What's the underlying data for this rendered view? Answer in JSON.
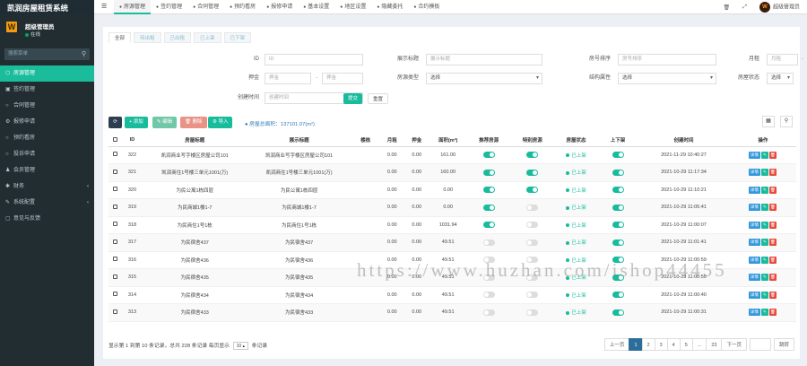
{
  "app": {
    "title": "凯润房屋租赁系统"
  },
  "user": {
    "name": "超级管理员",
    "status": "在线",
    "logo_letter": "W"
  },
  "sidebar": {
    "search_placeholder": "搜索菜单",
    "items": [
      {
        "label": "房源管理",
        "icon": "house-icon",
        "glyph": "⬡"
      },
      {
        "label": "签约管理",
        "icon": "contract-icon",
        "glyph": "▣"
      },
      {
        "label": "合同管理",
        "icon": "document-icon",
        "glyph": "○"
      },
      {
        "label": "报修申请",
        "icon": "repair-icon",
        "glyph": "⚙"
      },
      {
        "label": "预约看房",
        "icon": "calendar-icon",
        "glyph": "○"
      },
      {
        "label": "投诉申请",
        "icon": "complaint-icon",
        "glyph": "○"
      },
      {
        "label": "会员管理",
        "icon": "user-icon",
        "glyph": "♟"
      },
      {
        "label": "财务",
        "icon": "finance-icon",
        "glyph": "✱"
      },
      {
        "label": "系统配置",
        "icon": "settings-icon",
        "glyph": "✎"
      },
      {
        "label": "意见与反馈",
        "icon": "feedback-icon",
        "glyph": "▢"
      }
    ]
  },
  "topbar": {
    "tabs": [
      {
        "label": "房源管理"
      },
      {
        "label": "签约管理"
      },
      {
        "label": "合同管理"
      },
      {
        "label": "预约看房"
      },
      {
        "label": "报修申请"
      },
      {
        "label": "基本设置"
      },
      {
        "label": "地区设置"
      },
      {
        "label": "隐藏委托"
      },
      {
        "label": "合约模板"
      }
    ],
    "admin_name": "超级管理员"
  },
  "filter_tabs": [
    "全部",
    "待出租",
    "已出租",
    "已上架",
    "已下架"
  ],
  "filters": {
    "id": {
      "label": "ID",
      "placeholder": "ID"
    },
    "title": {
      "label": "展示标题",
      "placeholder": "展示标题"
    },
    "room_no": {
      "label": "房号排序",
      "placeholder": "房号排序"
    },
    "rent": {
      "label": "月租",
      "ph_min": "月租",
      "ph_max": "月租"
    },
    "deposit": {
      "label": "押金",
      "ph_min": "押金",
      "ph_max": "押金"
    },
    "source": {
      "label": "房源类型",
      "value": "选择"
    },
    "structure": {
      "label": "结构属性",
      "value": "选择"
    },
    "status": {
      "label": "房屋状态",
      "value": "选择"
    },
    "created": {
      "label": "创建时间",
      "placeholder": "创建时间"
    },
    "submit": "提交",
    "reset": "重置"
  },
  "toolbar": {
    "add": "+ 添加",
    "edit": "✎ 编辑",
    "delete": "🗑 删除",
    "import": "⚙ 导入",
    "stats": "房屋总面积：137101.07(m²)"
  },
  "table": {
    "headers": [
      "ID",
      "房屋标题",
      "展示标题",
      "楼栋",
      "月租",
      "押金",
      "面积(m²)",
      "推荐房源",
      "特别房源",
      "房屋状态",
      "上下架",
      "创建时间",
      "操作"
    ],
    "rows": [
      {
        "id": "322",
        "title": "凯润商业写字楼区房屋公司101",
        "show": "凯润商业写字楼区房屋公司101",
        "rent": "0.00",
        "deposit": "0.00",
        "area": "161.00",
        "rec": true,
        "special": true,
        "status": "已上架",
        "shelf": true,
        "created": "2021-11-29 10:40:27"
      },
      {
        "id": "321",
        "title": "凯润商住1号楼三单元1001(万)",
        "show": "凯润商住1号楼三单元1001(万)",
        "rent": "0.00",
        "deposit": "0.00",
        "area": "160.00",
        "rec": true,
        "special": true,
        "status": "已上架",
        "shelf": true,
        "created": "2021-10-29 11:17:34"
      },
      {
        "id": "320",
        "title": "为民公寓1栋四层",
        "show": "为民公寓1栋四层",
        "rent": "0.00",
        "deposit": "0.00",
        "area": "0.00",
        "rec": true,
        "special": true,
        "status": "已上架",
        "shelf": true,
        "created": "2021-10-29 11:10:21"
      },
      {
        "id": "319",
        "title": "为民商城1楼1-7",
        "show": "为民商城1楼1-7",
        "rent": "0.00",
        "deposit": "0.00",
        "area": "0.00",
        "rec": true,
        "special": false,
        "status": "已上架",
        "shelf": true,
        "created": "2021-10-29 11:05:41"
      },
      {
        "id": "318",
        "title": "为民商住1号1栋",
        "show": "为民商住1号1栋",
        "rent": "0.00",
        "deposit": "0.00",
        "area": "1031.94",
        "rec": true,
        "special": false,
        "status": "已上架",
        "shelf": true,
        "created": "2021-10-29 11:00:07"
      },
      {
        "id": "317",
        "title": "为民宿舍437",
        "show": "为民宿舍437",
        "rent": "0.00",
        "deposit": "0.00",
        "area": "49.51",
        "rec": false,
        "special": false,
        "status": "已上架",
        "shelf": true,
        "created": "2021-10-29 11:01:41"
      },
      {
        "id": "316",
        "title": "为民宿舍436",
        "show": "为民宿舍436",
        "rent": "0.00",
        "deposit": "0.00",
        "area": "49.51",
        "rec": false,
        "special": false,
        "status": "已上架",
        "shelf": true,
        "created": "2021-10-29 11:00:59"
      },
      {
        "id": "315",
        "title": "为民宿舍435",
        "show": "为民宿舍435",
        "rent": "0.00",
        "deposit": "0.00",
        "area": "49.51",
        "rec": false,
        "special": false,
        "status": "已上架",
        "shelf": true,
        "created": "2021-10-29 11:00:50"
      },
      {
        "id": "314",
        "title": "为民宿舍434",
        "show": "为民宿舍434",
        "rent": "0.00",
        "deposit": "0.00",
        "area": "49.51",
        "rec": false,
        "special": false,
        "status": "已上架",
        "shelf": true,
        "created": "2021-10-29 11:00:40"
      },
      {
        "id": "313",
        "title": "为民宿舍433",
        "show": "为民宿舍433",
        "rent": "0.00",
        "deposit": "0.00",
        "area": "49.51",
        "rec": false,
        "special": false,
        "status": "已上架",
        "shelf": true,
        "created": "2021-10-29 11:00:31"
      }
    ],
    "row_actions": {
      "detail": "详情"
    }
  },
  "pager": {
    "info_prefix": "显示第 1 到第 10 条记录，总共 228 条记录 每页显示",
    "page_size": "10",
    "info_suffix": "条记录",
    "prev": "上一页",
    "pages": [
      "1",
      "2",
      "3",
      "4",
      "5",
      "...",
      "23"
    ],
    "next": "下一页",
    "jump": "跳转"
  },
  "watermark": "https://www.huzhan.com/ishop44455",
  "colors": {
    "accent": "#18bc9c",
    "sidebar": "#222d32",
    "primary": "#2c6e9b",
    "danger": "#e74c3c",
    "info": "#3498db"
  }
}
